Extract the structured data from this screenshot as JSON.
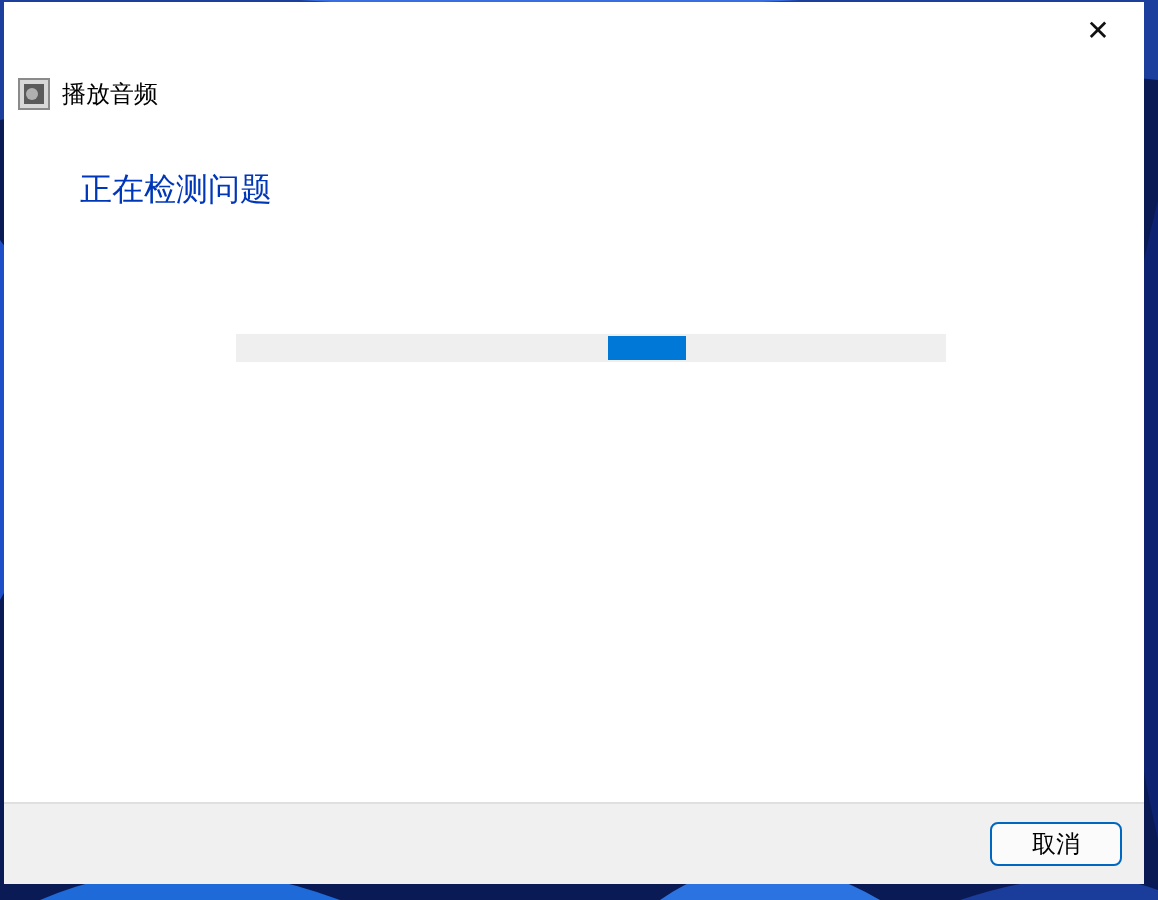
{
  "window": {
    "title": "播放音频",
    "close": "✕"
  },
  "heading": "正在检测问题",
  "progress": {
    "kind": "marquee"
  },
  "buttons": [
    {
      "label": "取消",
      "focused": true
    }
  ]
}
